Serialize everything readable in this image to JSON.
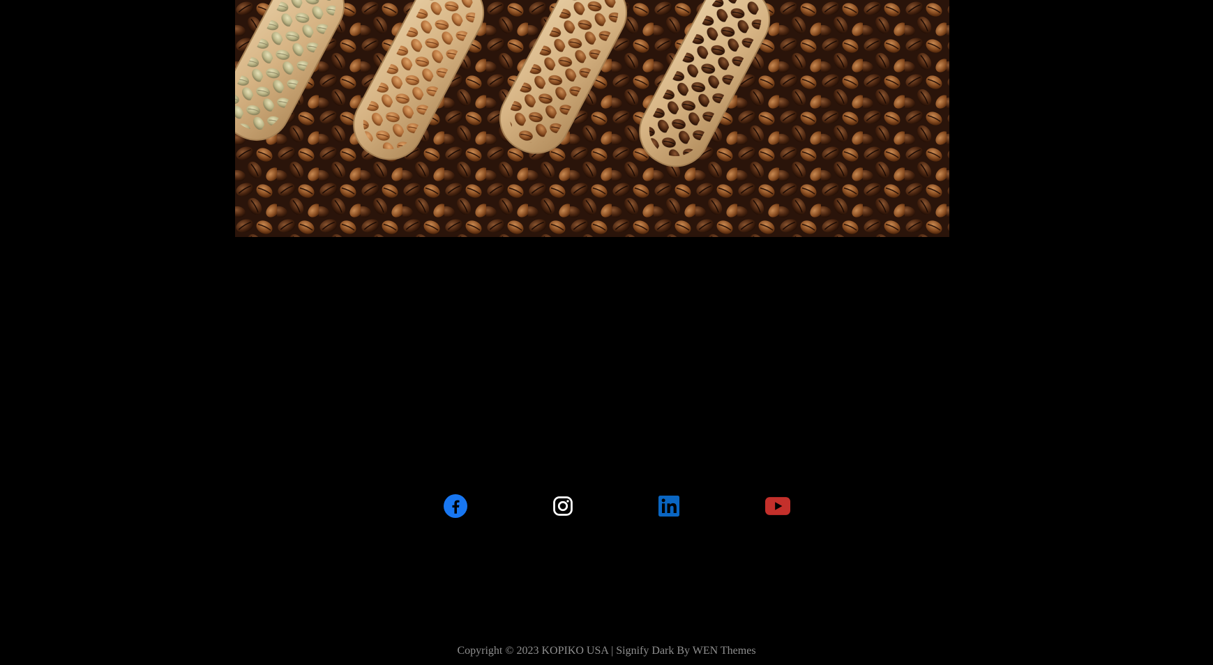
{
  "hero": {
    "image_alt": "Coffee beans in wooden scoops"
  },
  "social": {
    "items": [
      {
        "name": "facebook",
        "label": "Facebook",
        "color": "#1877F2"
      },
      {
        "name": "instagram",
        "label": "Instagram",
        "color": "#FFFFFF"
      },
      {
        "name": "linkedin",
        "label": "LinkedIn",
        "color": "#0A66C2"
      },
      {
        "name": "youtube",
        "label": "YouTube",
        "color": "#C4302B"
      }
    ]
  },
  "footer": {
    "copyright": "Copyright © 2023 KOPIKO USA",
    "separator": " | ",
    "theme_name": "Signify Dark",
    "by_text": " By ",
    "author": "WEN Themes"
  },
  "colors": {
    "background": "#000000",
    "footer_text": "#8f8f8f"
  }
}
